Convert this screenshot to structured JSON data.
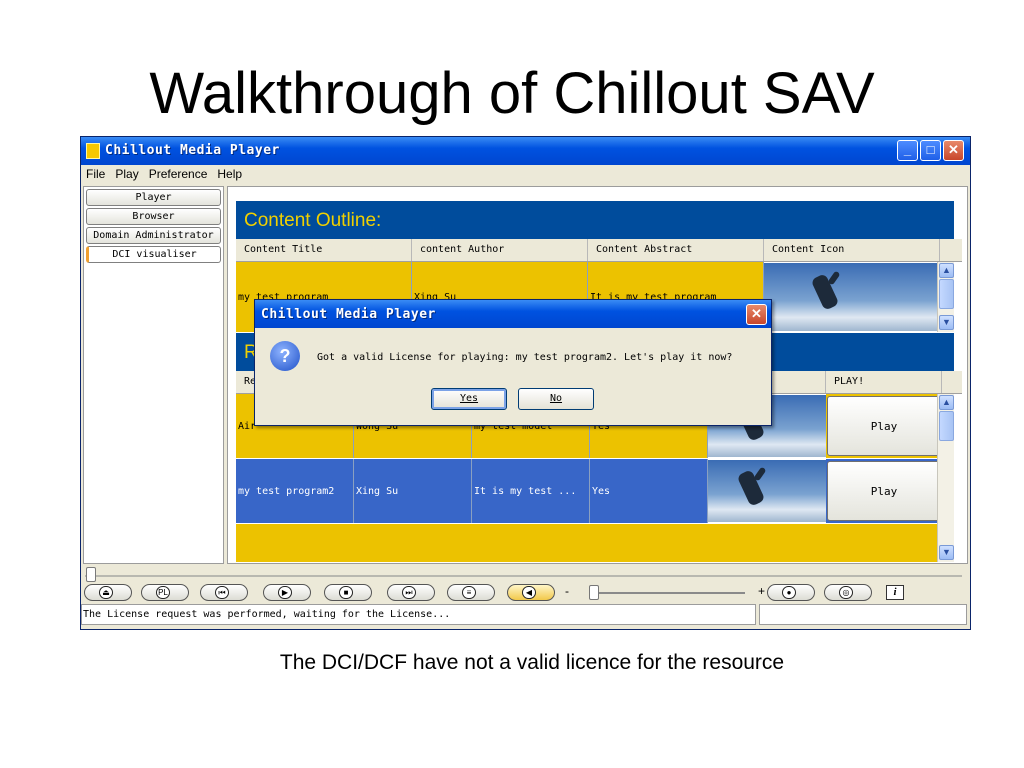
{
  "slide": {
    "title": "Walkthrough of Chillout SAV",
    "caption": "The DCI/DCF have not a valid licence for the resource"
  },
  "window": {
    "title": "Chillout Media Player",
    "controls": [
      "minimize",
      "maximize",
      "close"
    ]
  },
  "menu": [
    "File",
    "Play",
    "Preference",
    "Help"
  ],
  "sidebar": {
    "items": [
      {
        "label": "Player"
      },
      {
        "label": "Browser"
      },
      {
        "label": "Domain Administrator"
      },
      {
        "label": "DCI visualiser",
        "active": true
      }
    ]
  },
  "content_outline": {
    "heading": "Content Outline:",
    "columns": [
      "Content Title",
      "content Author",
      "Content Abstract",
      "Content Icon"
    ],
    "row": {
      "title": "my test program",
      "author": "Xing Su",
      "abstract": "It is my test program"
    }
  },
  "resources": {
    "heading": "R",
    "columns": [
      "Re",
      "Icon",
      "PLAY!"
    ],
    "rows": [
      {
        "title": "Air",
        "author": "Wong Su",
        "abstract": "my test model",
        "licensed": "Yes",
        "play": "Play"
      },
      {
        "title": "my test program2",
        "author": "Xing Su",
        "abstract": "It is my test ...",
        "licensed": "Yes",
        "play": "Play"
      }
    ]
  },
  "controls": {
    "volume_minus": "-",
    "volume_plus": "+",
    "icons": [
      "eject-icon",
      "playlist-icon",
      "previous-icon",
      "play-icon",
      "stop-icon",
      "next-icon",
      "equalizer-icon",
      "volume-icon",
      "record-icon",
      "fullscreen-icon",
      "info-icon"
    ]
  },
  "status": {
    "text": "The License request was performed, waiting for the License..."
  },
  "dialog": {
    "title": "Chillout Media Player",
    "message": "Got a valid License for playing: my test program2. Let's play it now?",
    "yes": "Yes",
    "no": "No"
  }
}
